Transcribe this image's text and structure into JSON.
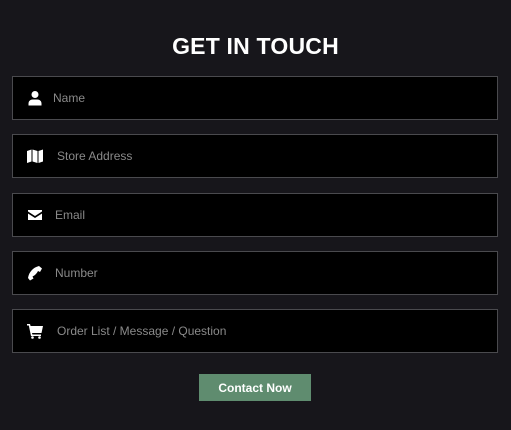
{
  "title": "GET IN TOUCH",
  "fields": [
    {
      "icon": "user-icon",
      "placeholder": "Name",
      "value": ""
    },
    {
      "icon": "map-icon",
      "placeholder": "Store Address",
      "value": ""
    },
    {
      "icon": "envelope-icon",
      "placeholder": "Email",
      "value": ""
    },
    {
      "icon": "phone-icon",
      "placeholder": "Number",
      "value": ""
    },
    {
      "icon": "cart-icon",
      "placeholder": "Order List / Message / Question",
      "value": ""
    }
  ],
  "submit_label": "Contact Now",
  "colors": {
    "background": "#17161b",
    "field_bg": "#000000",
    "button": "#5f8c6f"
  }
}
